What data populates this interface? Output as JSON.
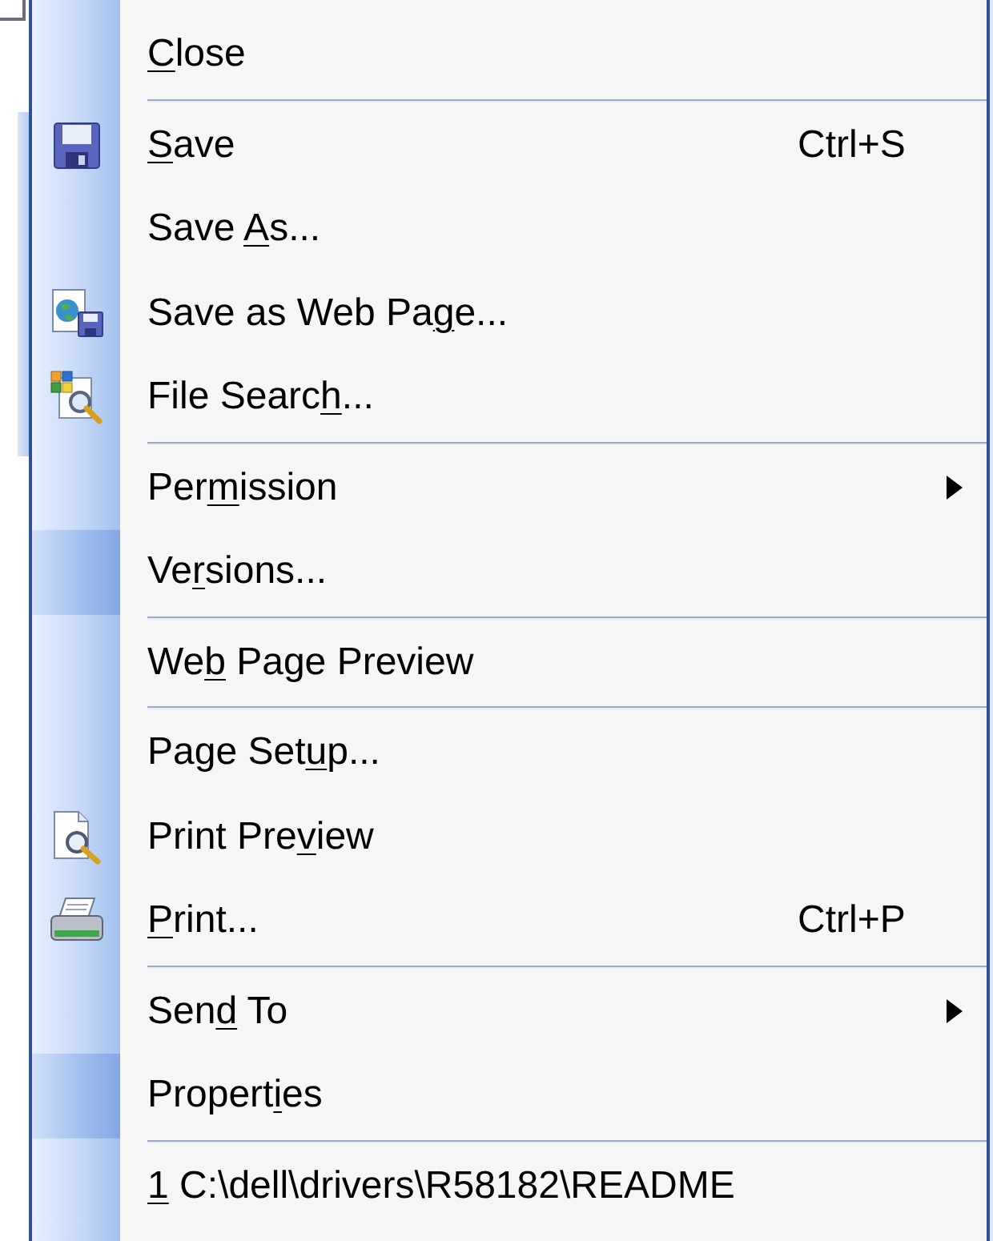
{
  "menu": {
    "items": [
      {
        "kind": "command",
        "label": "Close",
        "infrequent": false
      },
      {
        "kind": "separator"
      },
      {
        "kind": "command",
        "label": "Save",
        "shortcut": "Ctrl+S",
        "infrequent": false
      },
      {
        "kind": "command",
        "label": "Save As...",
        "infrequent": false
      },
      {
        "kind": "command",
        "label": "Save as Web Page...",
        "infrequent": false
      },
      {
        "kind": "command",
        "label": "File Search...",
        "infrequent": false
      },
      {
        "kind": "separator"
      },
      {
        "kind": "submenu",
        "label": "Permission",
        "infrequent": false
      },
      {
        "kind": "command",
        "label": "Versions...",
        "infrequent": true
      },
      {
        "kind": "separator"
      },
      {
        "kind": "command",
        "label": "Web Page Preview",
        "infrequent": false
      },
      {
        "kind": "separator"
      },
      {
        "kind": "command",
        "label": "Page Setup...",
        "infrequent": false
      },
      {
        "kind": "command",
        "label": "Print Preview",
        "infrequent": false
      },
      {
        "kind": "command",
        "label": "Print...",
        "shortcut": "Ctrl+P",
        "infrequent": false
      },
      {
        "kind": "separator"
      },
      {
        "kind": "submenu",
        "label": "Send To",
        "infrequent": false
      },
      {
        "kind": "command",
        "label": "Properties",
        "infrequent": true
      },
      {
        "kind": "separator"
      },
      {
        "kind": "command",
        "label": "1 C:\\dell\\drivers\\R58182\\README",
        "infrequent": false
      }
    ]
  }
}
